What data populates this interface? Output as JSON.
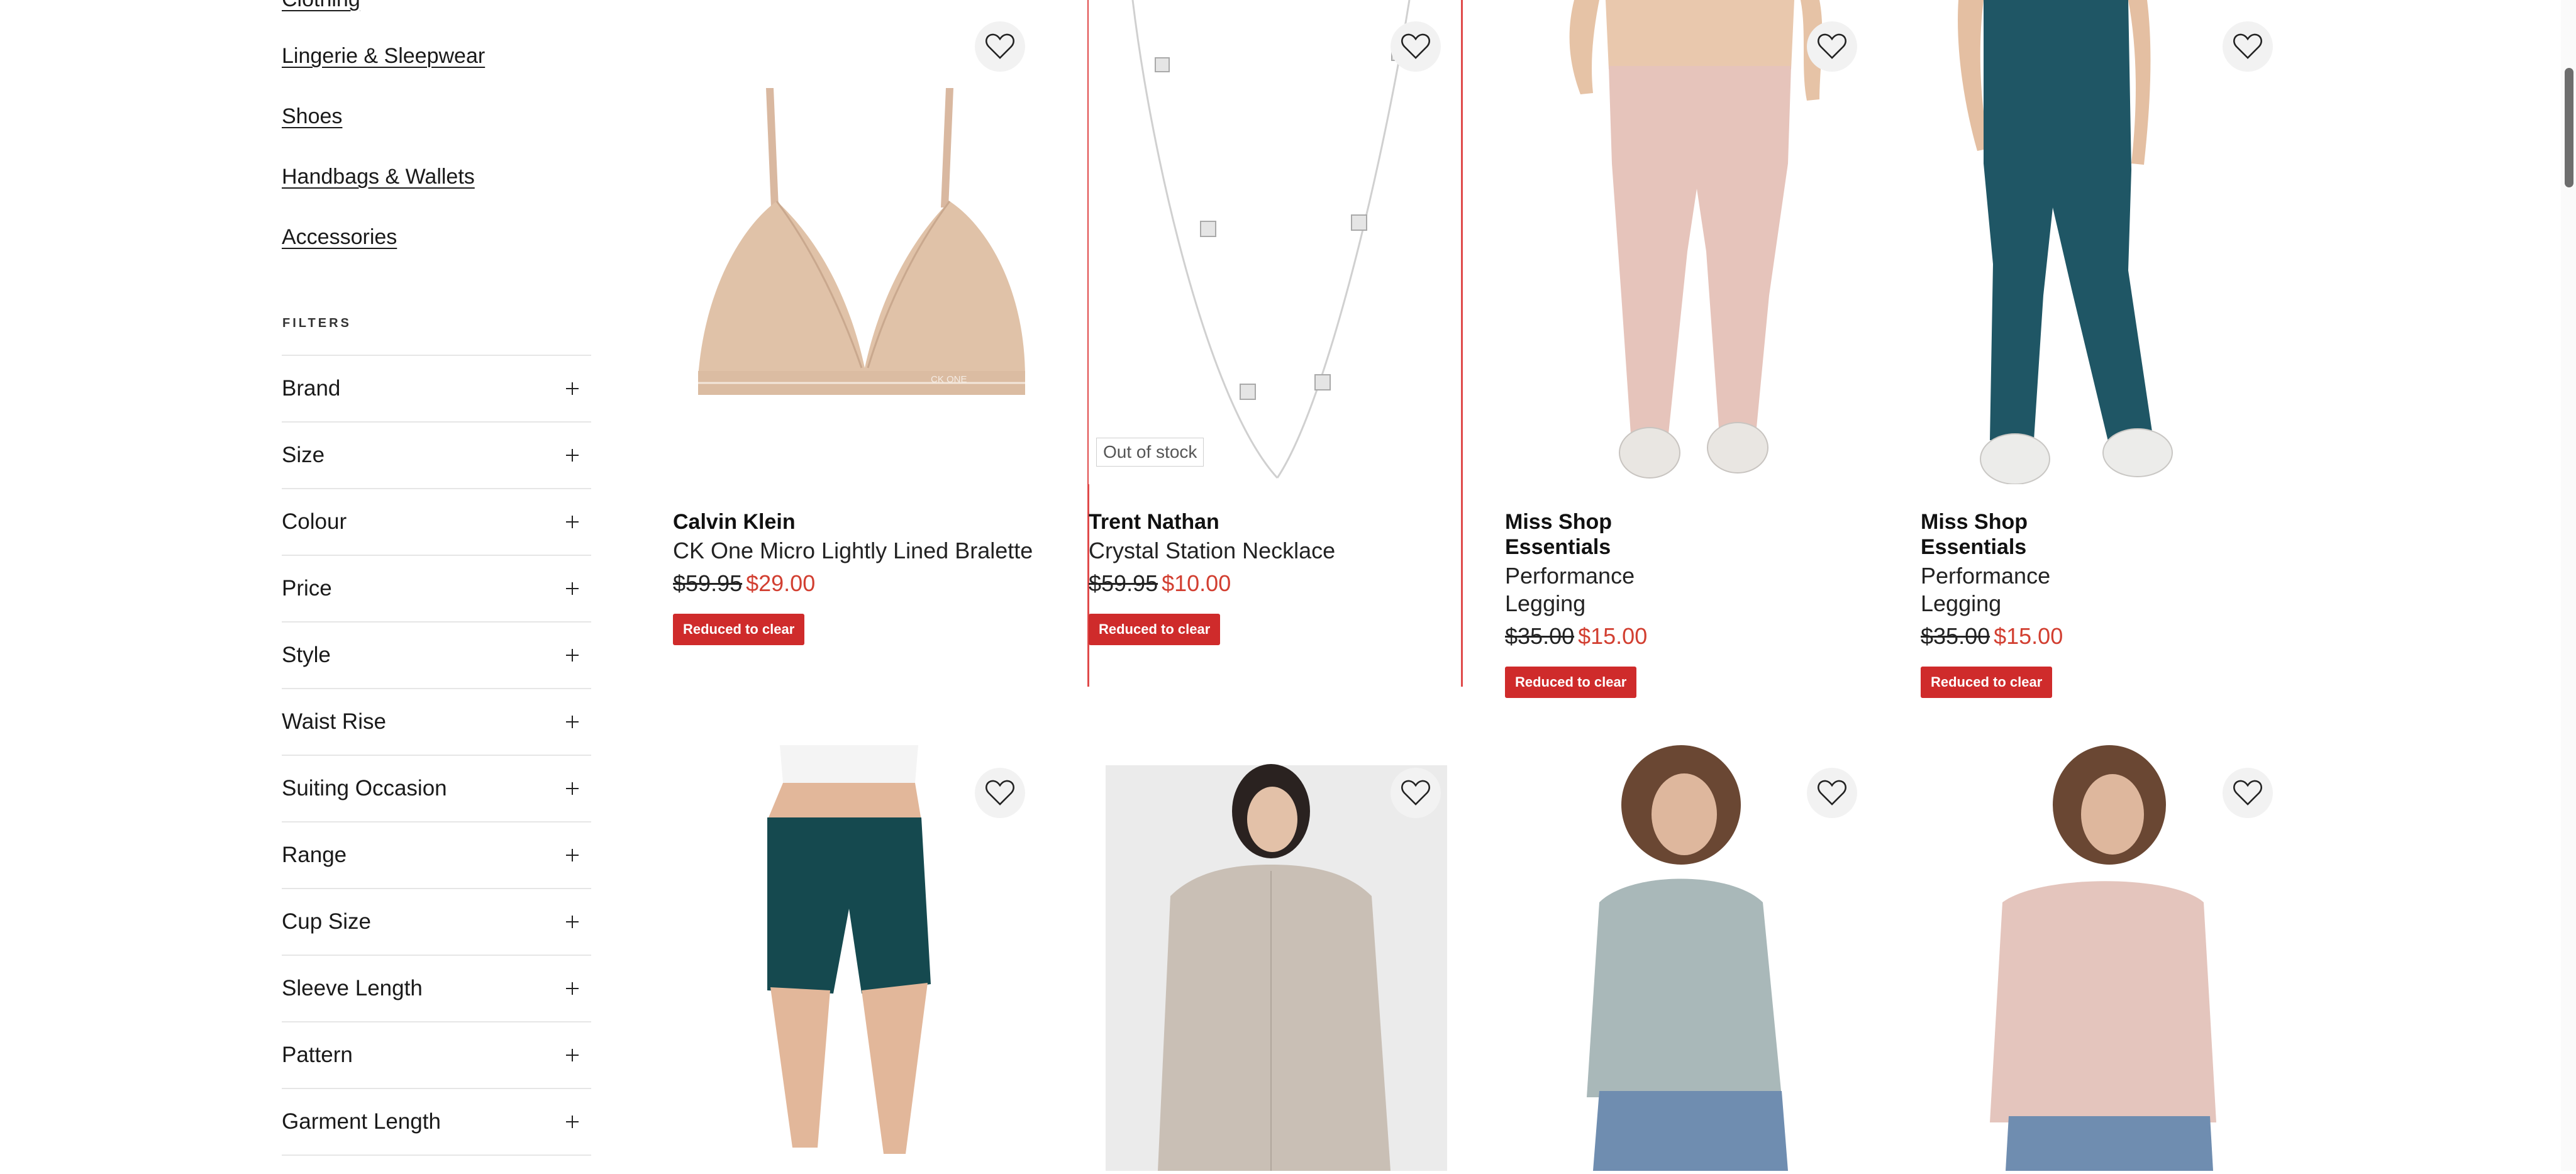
{
  "categories": [
    "Clothing",
    "Lingerie & Sleepwear",
    "Shoes",
    "Handbags & Wallets",
    "Accessories"
  ],
  "filters_heading": "FILTERS",
  "filters": [
    "Brand",
    "Size",
    "Colour",
    "Price",
    "Style",
    "Waist Rise",
    "Suiting Occasion",
    "Range",
    "Cup Size",
    "Sleeve Length",
    "Pattern",
    "Garment Length"
  ],
  "products": [
    {
      "brand": "Calvin Klein",
      "name": "CK One Micro Lightly Lined Bralette",
      "was": "$59.95",
      "now": "$29.00",
      "badge": "Reduced to clear",
      "image": "bralette-photo",
      "print": "CK ONE"
    },
    {
      "brand": "Trent Nathan",
      "name": "Crystal Station Necklace",
      "was": "$59.95",
      "now": "$10.00",
      "badge": "Reduced to clear",
      "image": "necklace-photo",
      "stock_label": "Out of stock"
    },
    {
      "brand": "Miss Shop Essentials",
      "name": "Performance Legging",
      "was": "$35.00",
      "now": "$15.00",
      "badge": "Reduced to clear",
      "image": "pink-legging-photo"
    },
    {
      "brand": "Miss Shop Essentials",
      "name": "Performance Legging",
      "was": "$35.00",
      "now": "$15.00",
      "badge": "Reduced to clear",
      "image": "teal-legging-photo"
    }
  ],
  "second_row_images": [
    "bike-shorts-photo",
    "satin-shirt-photo",
    "sage-sweatshirt-photo",
    "pink-sweatshirt-photo"
  ],
  "colors": {
    "sale_red": "#d23f31",
    "badge_red": "#cf2b2b",
    "divider": "#e6e6e6",
    "focus_outline": "#e04a4a"
  }
}
